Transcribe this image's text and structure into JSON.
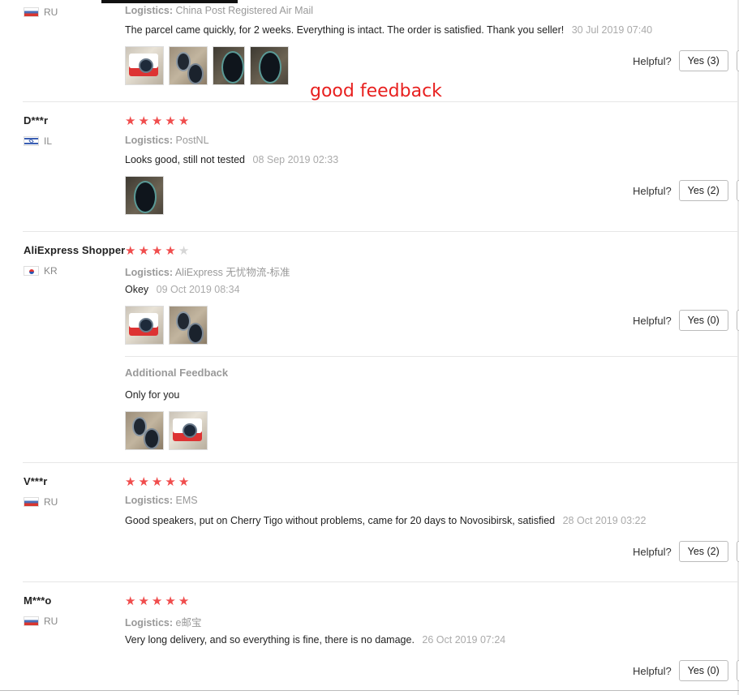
{
  "reviews": [
    {
      "user": "",
      "country": "RU",
      "logistics_label": "Logistics:",
      "logistics": "China Post Registered Air Mail",
      "text": "The parcel came quickly, for 2 weeks. Everything is intact. The order is satisfied. Thank you seller!",
      "date": "30 Jul 2019 07:40",
      "helpful_label": "Helpful?",
      "yes_label": "Yes (3)",
      "photo_count": 4
    },
    {
      "user": "D***r",
      "country": "IL",
      "rating": 5,
      "logistics_label": "Logistics:",
      "logistics": "PostNL",
      "text": "Looks good, still not tested",
      "date": "08 Sep 2019 02:33",
      "helpful_label": "Helpful?",
      "yes_label": "Yes (2)",
      "photo_count": 1
    },
    {
      "user": "AliExpress Shopper",
      "country": "KR",
      "rating": 4,
      "logistics_label": "Logistics:",
      "logistics": "AliExpress 无忧物流-标准",
      "text": "Okey",
      "date": "09 Oct 2019 08:34",
      "helpful_label": "Helpful?",
      "yes_label": "Yes (0)",
      "photo_count": 2,
      "additional_feedback": {
        "title": "Additional Feedback",
        "text": "Only for you",
        "photo_count": 2
      }
    },
    {
      "user": "V***r",
      "country": "RU",
      "rating": 5,
      "logistics_label": "Logistics:",
      "logistics": "EMS",
      "text": "Good speakers, put on Cherry Tigo without problems, came for 20 days to Novosibirsk, satisfied",
      "date": "28 Oct 2019 03:22",
      "helpful_label": "Helpful?",
      "yes_label": "Yes (2)",
      "photo_count": 0
    },
    {
      "user": "M***o",
      "country": "RU",
      "rating": 5,
      "logistics_label": "Logistics:",
      "logistics": "e邮宝",
      "text": "Very long delivery, and so everything is fine, there is no damage.",
      "date": "26 Oct 2019 07:24",
      "helpful_label": "Helpful?",
      "yes_label": "Yes (0)",
      "photo_count": 0
    }
  ],
  "annotation": "good feedback",
  "colors": {
    "star": "#f04d4d",
    "star_off": "#d6d6d6",
    "annotation": "#e8201f"
  },
  "icons": {
    "star": "star-icon",
    "flag_ru": "flag-ru-icon",
    "flag_il": "flag-il-icon",
    "flag_kr": "flag-kr-icon"
  }
}
